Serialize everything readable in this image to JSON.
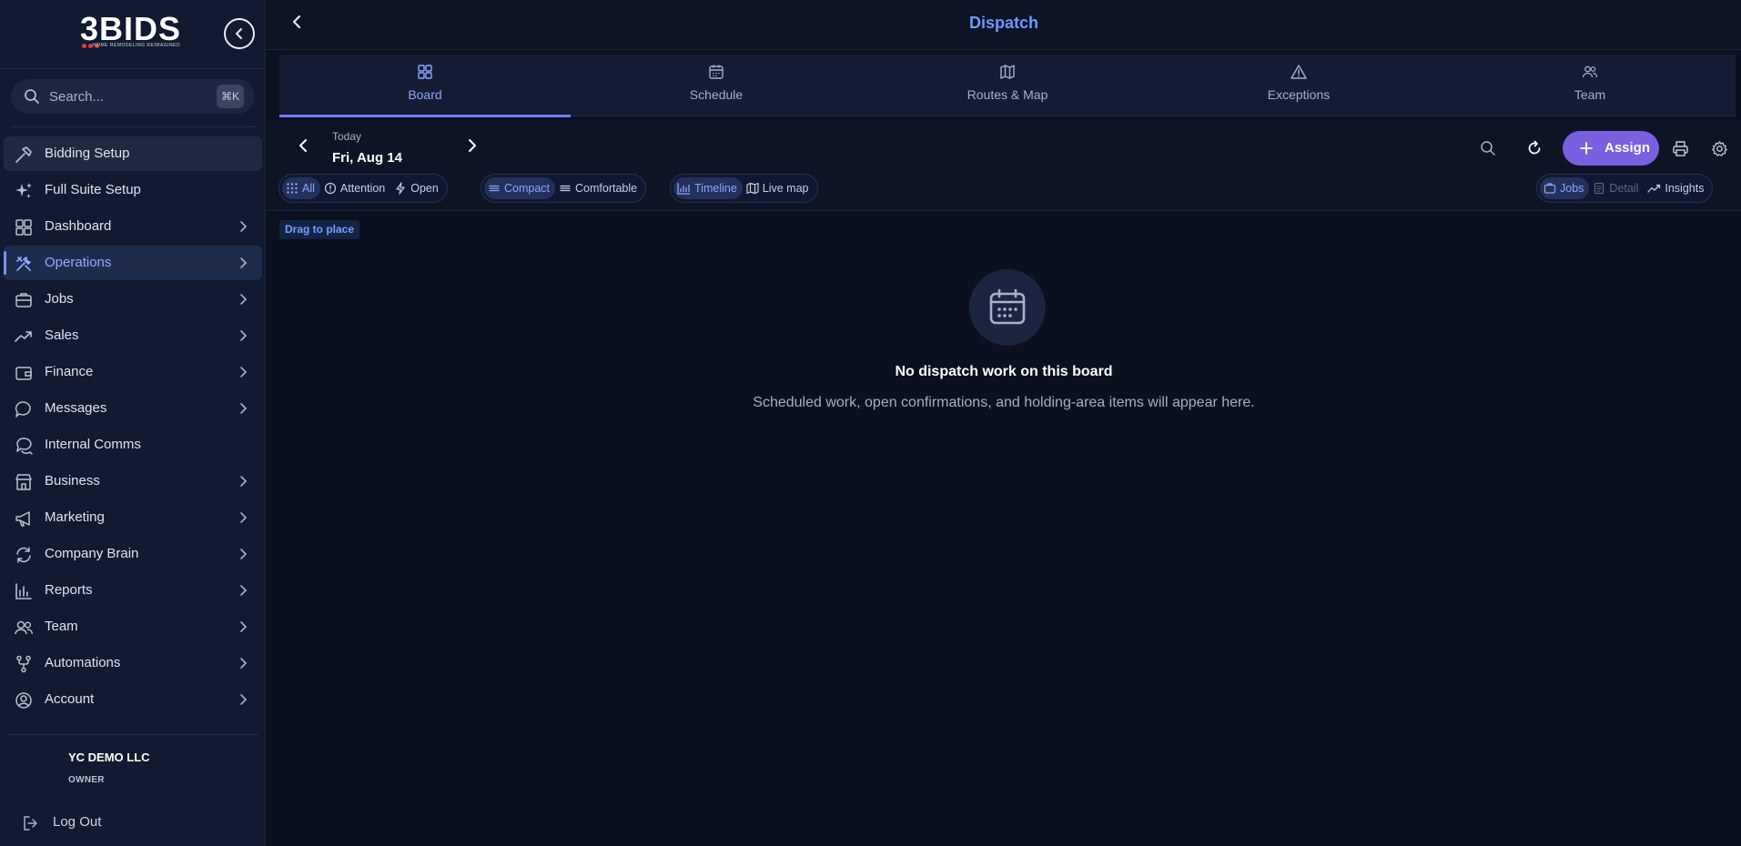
{
  "sidebar": {
    "logo": {
      "text": "3BIDS",
      "tagline": "HOME REMODELING REIMAGINED"
    },
    "search": {
      "placeholder": "Search...",
      "shortcut": "⌘K"
    },
    "items": [
      {
        "label": "Bidding Setup",
        "icon": "hammer-icon",
        "chevron": false
      },
      {
        "label": "Full Suite Setup",
        "icon": "sparkles-icon",
        "chevron": false
      },
      {
        "label": "Dashboard",
        "icon": "grid-icon",
        "chevron": true
      },
      {
        "label": "Operations",
        "icon": "tools-icon",
        "chevron": true
      },
      {
        "label": "Jobs",
        "icon": "briefcase-icon",
        "chevron": true
      },
      {
        "label": "Sales",
        "icon": "trending-up-icon",
        "chevron": true
      },
      {
        "label": "Finance",
        "icon": "wallet-icon",
        "chevron": true
      },
      {
        "label": "Messages",
        "icon": "chat-bubble-icon",
        "chevron": true
      },
      {
        "label": "Internal Comms",
        "icon": "chat-bubbles-icon",
        "chevron": false
      },
      {
        "label": "Business",
        "icon": "store-icon",
        "chevron": true
      },
      {
        "label": "Marketing",
        "icon": "megaphone-icon",
        "chevron": true
      },
      {
        "label": "Company Brain",
        "icon": "refresh-cycle-icon",
        "chevron": true
      },
      {
        "label": "Reports",
        "icon": "bar-chart-icon",
        "chevron": true
      },
      {
        "label": "Team",
        "icon": "users-icon",
        "chevron": true
      },
      {
        "label": "Automations",
        "icon": "branch-icon",
        "chevron": true
      },
      {
        "label": "Account",
        "icon": "user-circle-icon",
        "chevron": true
      }
    ],
    "company": "YC DEMO LLC",
    "role": "OWNER",
    "logout": "Log Out"
  },
  "header": {
    "title": "Dispatch"
  },
  "tabs": [
    {
      "label": "Board",
      "icon": "board-grid-icon",
      "active": true
    },
    {
      "label": "Schedule",
      "icon": "calendar-icon",
      "active": false
    },
    {
      "label": "Routes & Map",
      "icon": "map-icon",
      "active": false
    },
    {
      "label": "Exceptions",
      "icon": "warning-triangle-icon",
      "active": false
    },
    {
      "label": "Team",
      "icon": "users-icon",
      "active": false
    }
  ],
  "toolbar": {
    "date_caption": "Today",
    "date_value": "Fri, Aug 14",
    "assign_label": "Assign",
    "filters": {
      "all": "All",
      "attention": "Attention",
      "open": "Open"
    },
    "density": {
      "compact": "Compact",
      "comfortable": "Comfortable"
    },
    "views": {
      "timeline": "Timeline",
      "live_map": "Live map"
    },
    "panels": {
      "jobs": "Jobs",
      "detail": "Detail",
      "insights": "Insights"
    }
  },
  "board": {
    "drag_hint": "Drag to place",
    "empty_title": "No dispatch work on this board",
    "empty_subtitle": "Scheduled work, open confirmations, and holding-area items will appear here."
  },
  "colors": {
    "accent": "#7a5fe0",
    "link": "#6f98ff",
    "background": "#0a1020",
    "sidebar": "#111a30"
  }
}
